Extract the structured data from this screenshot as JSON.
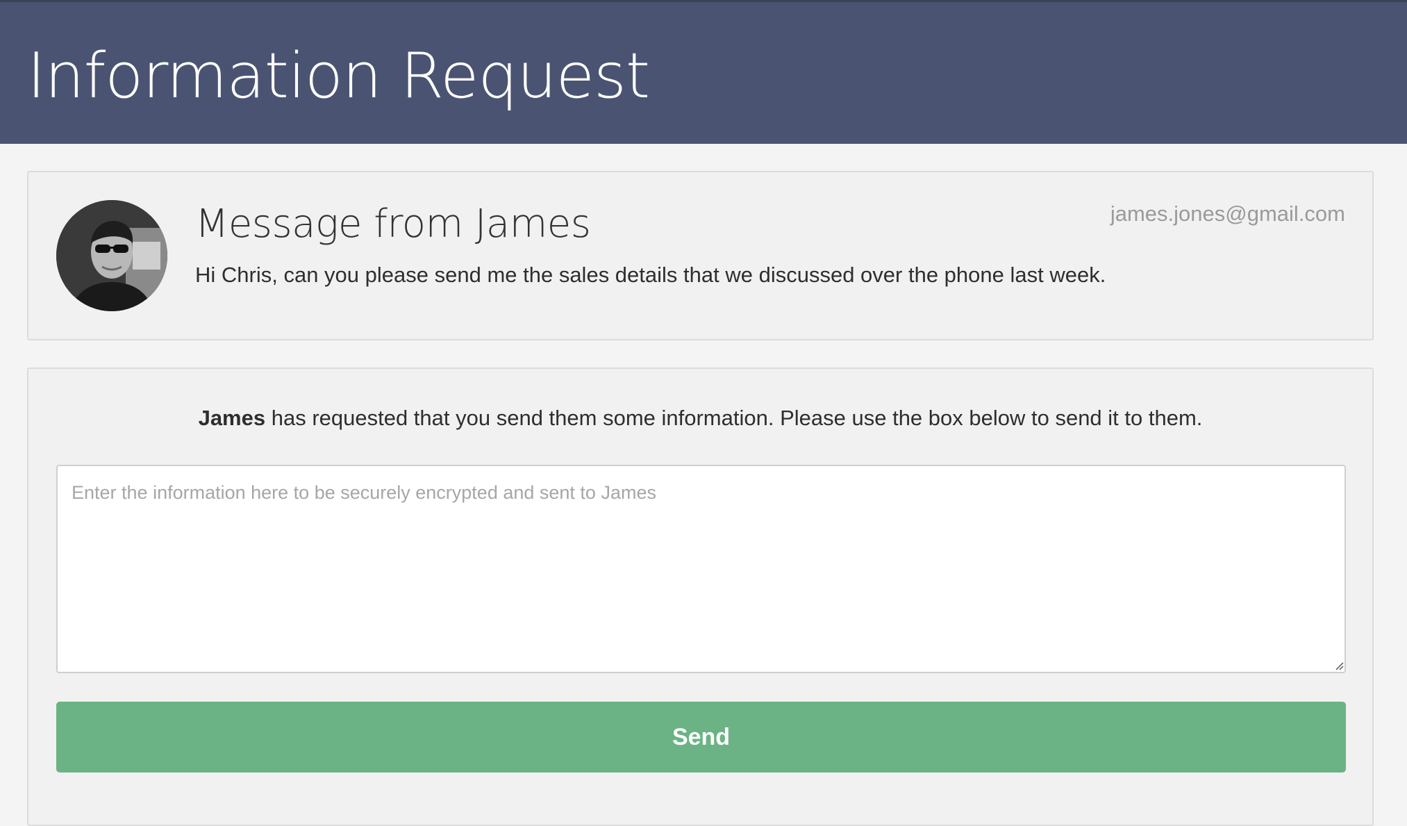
{
  "header": {
    "title": "Information Request",
    "background_color": "#4a5472"
  },
  "message": {
    "title": "Message from James",
    "sender_email": "james.jones@gmail.com",
    "body": "Hi Chris, can you please send me the sales details that we discussed over the phone last week.",
    "avatar_icon": "user-photo-avatar"
  },
  "request": {
    "sender_name": "James",
    "instruction_rest": " has requested that you send them some information. Please use the box below to send it to them.",
    "textarea_placeholder": "Enter the information here to be securely encrypted and sent to James",
    "send_label": "Send",
    "send_color": "#6bb384"
  }
}
